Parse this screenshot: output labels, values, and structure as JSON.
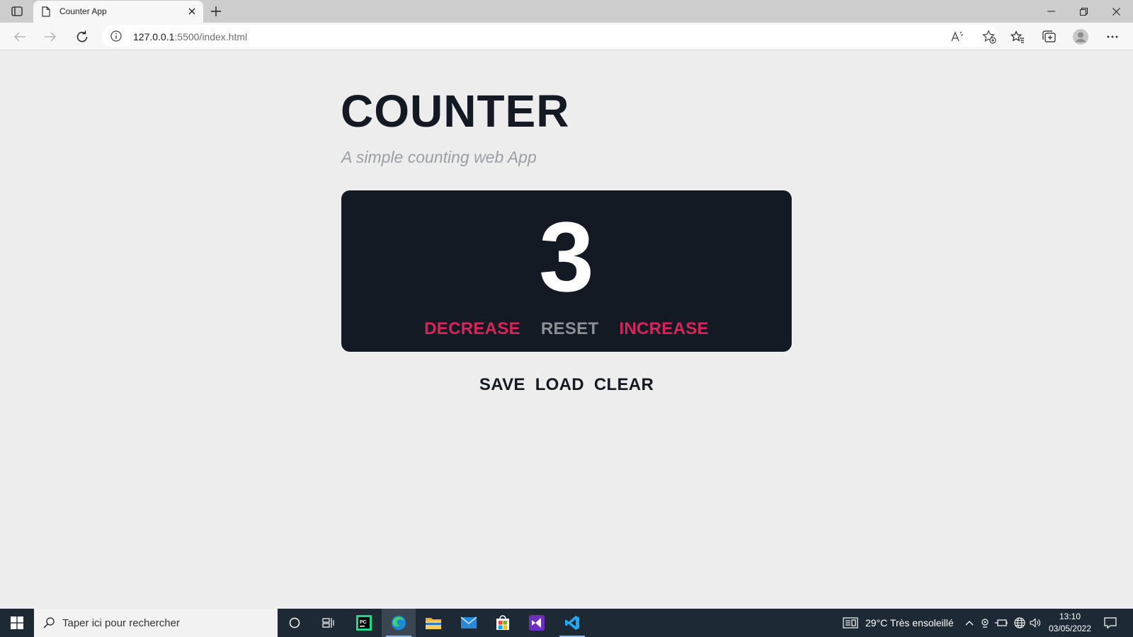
{
  "browser": {
    "tab_title": "Counter App",
    "url_host": "127.0.0.1",
    "url_rest": ":5500/index.html"
  },
  "page": {
    "title": "COUNTER",
    "subtitle": "A simple counting web App",
    "counter_value": "3",
    "buttons": {
      "decrease": "DECREASE",
      "reset": "RESET",
      "increase": "INCREASE"
    },
    "storage_buttons": {
      "save": "SAVE",
      "load": "LOAD",
      "clear": "CLEAR"
    },
    "colors": {
      "dark": "#141a24",
      "accent_red": "#d8245a",
      "reset_grey": "#8c8f94",
      "page_background": "#ededed"
    }
  },
  "taskbar": {
    "search_placeholder": "Taper ici pour rechercher",
    "weather": "29°C  Très ensoleillé",
    "time": "13:10",
    "date": "03/05/2022",
    "apps": [
      "task-view-icon",
      "widgets-icon",
      "pycharm-icon",
      "edge-icon",
      "file-explorer-icon",
      "mail-icon",
      "store-icon",
      "visual-studio-icon",
      "vscode-icon"
    ]
  }
}
